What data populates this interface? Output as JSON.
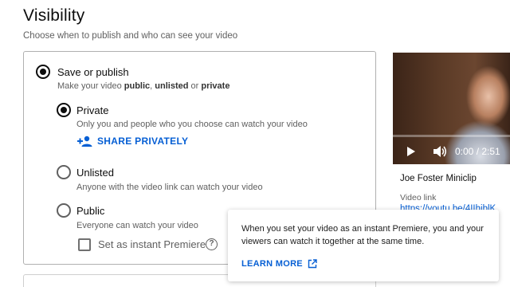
{
  "page": {
    "title": "Visibility",
    "subtitle": "Choose when to publish and who can see your video"
  },
  "save_publish": {
    "label": "Save or publish",
    "desc_prefix": "Make your video ",
    "desc_public": "public",
    "desc_sep1": ", ",
    "desc_unlisted": "unlisted",
    "desc_sep2": " or ",
    "desc_private": "private",
    "selected": true
  },
  "options": {
    "private": {
      "label": "Private",
      "desc": "Only you and people who you choose can watch your video",
      "selected": true
    },
    "unlisted": {
      "label": "Unlisted",
      "desc": "Anyone with the video link can watch your video",
      "selected": false
    },
    "public": {
      "label": "Public",
      "desc": "Everyone can watch your video",
      "selected": false
    }
  },
  "share": {
    "label": "SHARE PRIVATELY",
    "icon": "add-person-icon"
  },
  "premiere": {
    "label": "Set as instant Premiere",
    "checked": false,
    "help_glyph": "?"
  },
  "tooltip": {
    "text": "When you set your video as an instant Premiere, you and your viewers can watch it together at the same time.",
    "link_label": "LEARN MORE",
    "link_icon": "external-link-icon"
  },
  "video": {
    "time": "0:00 / 2:51",
    "title": "Joe Foster Miniclip",
    "link_label": "Video link",
    "link_text": "https://youtu.be/4IIhjblK"
  },
  "colors": {
    "accent": "#065fd4",
    "text": "#0d0d0d",
    "secondary": "#606060"
  }
}
